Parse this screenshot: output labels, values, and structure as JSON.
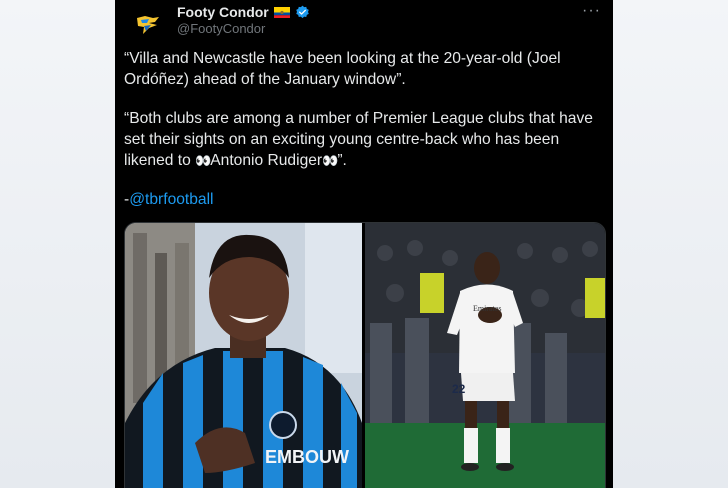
{
  "author": {
    "display_name": "Footy Condor",
    "handle": "@FootyCondor",
    "flag_icon": "ecuador-flag-icon",
    "verified_icon": "verified-badge-icon"
  },
  "more_menu": {
    "label": "···"
  },
  "tweet": {
    "paragraph1": "“Villa and Newcastle have been looking at the 20-year-old (Joel Ordóñez) ahead of the January window”.",
    "paragraph2_start": "“Both clubs are among a number of Premier League clubs that have set their sights on an exciting young centre-back who has been likened to ",
    "eyes_emoji": "👀",
    "paragraph2_name": "Antonio Rudiger",
    "paragraph2_end": "”.",
    "credit_prefix": "-",
    "credit_mention": "@tbrfootball"
  },
  "media": {
    "left_photo_text": "EMBOUW",
    "right_photo_shirt_number": "22",
    "right_photo_sponsor": "Emirates"
  },
  "colors": {
    "background": "#000000",
    "text": "#e7e9ea",
    "handle": "#71767b",
    "link": "#1d9bf0",
    "verified": "#1d9bf0"
  }
}
